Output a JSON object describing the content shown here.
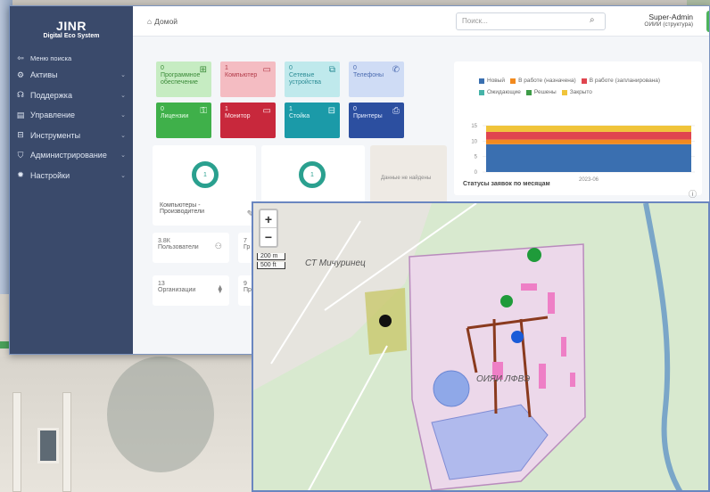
{
  "app": {
    "logo_title": "JINR",
    "logo_subtitle": "Digital Eco System",
    "topbar": {
      "home_label": "Домой",
      "search_placeholder": "Поиск...",
      "user_name": "Super-Admin",
      "user_role": "ОИИИ (структура)"
    }
  },
  "sidebar": {
    "items": [
      {
        "label": "Меню поиска",
        "icon": "search-menu-icon"
      },
      {
        "label": "Активы",
        "icon": "gear-icon"
      },
      {
        "label": "Поддержка",
        "icon": "headset-icon"
      },
      {
        "label": "Управление",
        "icon": "clipboard-icon"
      },
      {
        "label": "Инструменты",
        "icon": "toolbox-icon"
      },
      {
        "label": "Администрирование",
        "icon": "shield-icon"
      },
      {
        "label": "Настройки",
        "icon": "settings-icon"
      }
    ]
  },
  "tiles": [
    {
      "count": "0",
      "label": "Программное обеспечение",
      "color": "#6fcf6f"
    },
    {
      "count": "1",
      "label": "Компьютер",
      "color": "#e66c7a"
    },
    {
      "count": "0",
      "label": "Сетевые устройства",
      "color": "#7ed0d6"
    },
    {
      "count": "0",
      "label": "Телефоны",
      "color": "#a9c1ea"
    },
    {
      "count": "0",
      "label": "Лицензии",
      "color": "#3fb04a"
    },
    {
      "count": "1",
      "label": "Монитор",
      "color": "#c8283c"
    },
    {
      "count": "1",
      "label": "Стойка",
      "color": "#1b9aa8"
    },
    {
      "count": "0",
      "label": "Принтеры",
      "color": "#2c4fa0"
    }
  ],
  "widgets": {
    "ring1_value": "1",
    "ring2_value": "1",
    "empty_text": "Данные не найдены",
    "ring1_caption": "Компьютеры - Производители"
  },
  "stats": [
    {
      "value": "3.8К",
      "label": "Пользователи"
    },
    {
      "value": "7",
      "label": "Гр"
    },
    {
      "value": "13",
      "label": "Организации"
    },
    {
      "value": "9",
      "label": "Пр"
    }
  ],
  "chart_data": {
    "type": "bar",
    "title": "Статусы заявок по месяцам",
    "categories": [
      "2023-06"
    ],
    "stacked": true,
    "ylim": [
      0,
      15
    ],
    "yticks": [
      "0",
      "5",
      "10",
      "15"
    ],
    "series": [
      {
        "name": "Новый",
        "color": "#3a6fb0",
        "values": [
          9
        ]
      },
      {
        "name": "В работе (назначена)",
        "color": "#f28a1e",
        "values": [
          1.5
        ]
      },
      {
        "name": "В работе (запланирована)",
        "color": "#e0454f",
        "values": [
          2.5
        ]
      },
      {
        "name": "Ожидающие",
        "color": "#45b3a8",
        "values": [
          0
        ]
      },
      {
        "name": "Решены",
        "color": "#3e9c48",
        "values": [
          0
        ]
      },
      {
        "name": "Закрыто",
        "color": "#f0c43a",
        "values": [
          2
        ]
      }
    ],
    "legend": "top"
  },
  "map": {
    "scale_m": "200 m",
    "scale_ft": "500 ft",
    "place_label": "СТ Мичуринец",
    "area_label": "ОИЯИ ЛФВЭ",
    "zoom_in": "+",
    "zoom_out": "−"
  },
  "colors": {
    "sidebar": "#3a4a6b",
    "accent_green": "#4db35c"
  }
}
